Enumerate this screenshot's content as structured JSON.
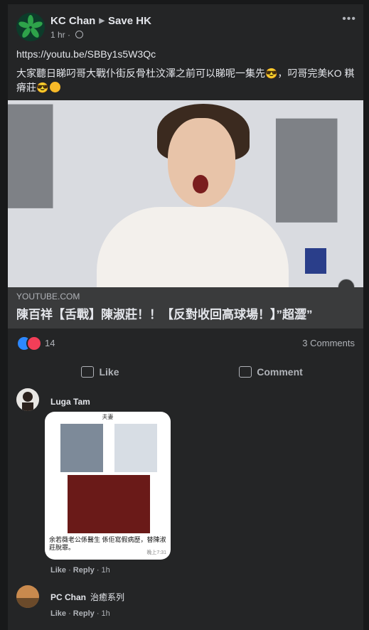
{
  "post": {
    "author": "KC Chan",
    "group": "Save HK",
    "time": "1 hr",
    "more": "•••",
    "link": "https://youtu.be/SBBy1s5W3Qc",
    "text": "大家聽日睇叼哥大戰仆街反骨杜汶澤之前可以睇呢一集先😎，叼哥完美KO 粸瘠莊😎"
  },
  "link_preview": {
    "domain": "YOUTUBE.COM",
    "title": "陳百祥【舌戰】陳淑莊！！【反對收回高球場！】”超澀”"
  },
  "stats": {
    "reaction_count": "14",
    "comments": "3 Comments"
  },
  "actions": {
    "like": "Like",
    "comment": "Comment"
  },
  "comments": [
    {
      "name": "Luga Tam",
      "text": "",
      "image": {
        "header": "夫妻",
        "caption": "余若薇老公係醫生 係佢寫假病歷，替陳淑莊脫罪。",
        "timestamp": "晚上7:31"
      },
      "like": "Like",
      "reply": "Reply",
      "time": "1h"
    },
    {
      "name": "PC Chan",
      "text": "治癒系列",
      "like": "Like",
      "reply": "Reply",
      "time": "1h"
    }
  ],
  "colors": {
    "background": "#18191a",
    "card": "#242526",
    "like_blue": "#2d88ff",
    "love_red": "#f33e58"
  },
  "icons": [
    "globe-icon",
    "more-icon",
    "like-reaction-icon",
    "love-reaction-icon",
    "like-icon",
    "comment-icon",
    "play-icon"
  ]
}
